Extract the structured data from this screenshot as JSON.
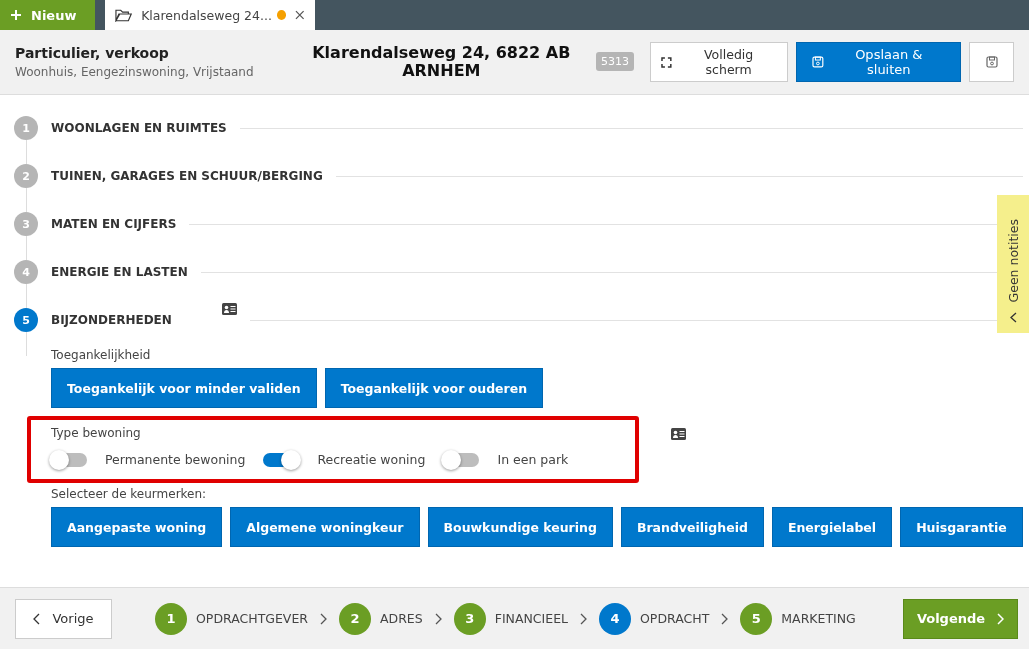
{
  "top_bar": {
    "new_button": "Nieuw",
    "tabs": [
      {
        "label": "Klarendalseweg 24...",
        "unsaved": true,
        "selected": true
      }
    ]
  },
  "header": {
    "title": "Particulier, verkoop",
    "subtitle": "Woonhuis, Eengezinswoning, Vrijstaand",
    "address": "Klarendalseweg 24, 6822 AB ARNHEM",
    "badge": "5313",
    "fullscreen_button": "Volledig scherm",
    "save_close_button": "Opslaan & sluiten"
  },
  "sections": [
    {
      "number": "1",
      "title": "WOONLAGEN EN RUIMTES",
      "selected": false
    },
    {
      "number": "2",
      "title": "TUINEN, GARAGES EN SCHUUR/BERGING",
      "selected": false
    },
    {
      "number": "3",
      "title": "MATEN EN CIJFERS",
      "selected": false
    },
    {
      "number": "4",
      "title": "ENERGIE EN LASTEN",
      "selected": false
    },
    {
      "number": "5",
      "title": "BIJZONDERHEDEN",
      "selected": true
    }
  ],
  "details": {
    "accessibility": {
      "label": "Toegankelijkheid",
      "options": [
        "Toegankelijk voor minder validen",
        "Toegankelijk voor ouderen"
      ]
    },
    "occupancy": {
      "label": "Type bewoning",
      "toggles": [
        {
          "label": "Permanente bewoning",
          "on": false
        },
        {
          "label": "Recreatie woning",
          "on": true
        },
        {
          "label": "In een park",
          "on": false
        }
      ]
    },
    "quality_marks": {
      "label": "Selecteer de keurmerken:",
      "options": [
        "Aangepaste woning",
        "Algemene woningkeur",
        "Bouwkundige keuring",
        "Brandveiligheid",
        "Energielabel",
        "Huisgarantie"
      ]
    }
  },
  "notes_tab": "Geen notities",
  "footer": {
    "previous_button": "Vorige",
    "steps": [
      {
        "number": "1",
        "label": "OPDRACHTGEVER",
        "selected": false
      },
      {
        "number": "2",
        "label": "ADRES",
        "selected": false
      },
      {
        "number": "3",
        "label": "FINANCIEEL",
        "selected": false
      },
      {
        "number": "4",
        "label": "OPDRACHT",
        "selected": true
      },
      {
        "number": "5",
        "label": "MARKETING",
        "selected": false
      }
    ],
    "next_button": "Volgende"
  }
}
